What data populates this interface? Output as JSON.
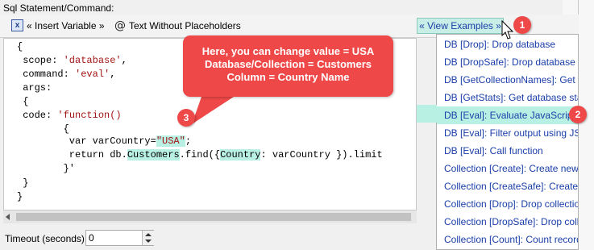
{
  "section_label": "Sql Statement/Command:",
  "toolbar": {
    "insert_variable_icon": "x",
    "insert_variable_label": "« Insert Variable »",
    "text_without_placeholders_icon": "@",
    "text_without_placeholders_label": "Text Without Placeholders",
    "view_examples_label": "« View Examples »"
  },
  "code": {
    "l1": "{",
    "l2a": " scope: ",
    "l2b": "'database'",
    "l2c": ",",
    "l3a": " command: ",
    "l3b": "'eval'",
    "l3c": ",",
    "l4": " args:",
    "l5": " {",
    "l6a": " code: ",
    "l6b": "'function()",
    "l7": "        {",
    "l8a": "         var varCountry=",
    "l8b": "\"USA\"",
    "l8c": ";",
    "l9a": "         return db.",
    "l9b": "Customers",
    "l9c": ".find({",
    "l9d": "Country",
    "l9e": ": varCountry }).limit",
    "l10": "        }'",
    "l11": " }",
    "l12": "}"
  },
  "timeout": {
    "label": "Timeout (seconds):",
    "value": "0"
  },
  "examples_menu": {
    "items": [
      "DB [Drop]: Drop database",
      "DB [DropSafe]: Drop database if exis",
      "DB [GetCollectionNames]: Get colle",
      "DB [GetStats]: Get database statistic",
      "DB [Eval]: Evaluate JavaScript",
      "DB [Eval]: Filter output using JSONP",
      "DB [Eval]: Call function",
      "Collection [Create]: Create new coll",
      "Collection [CreateSafe]: Create new",
      "Collection [Drop]: Drop collection",
      "Collection [DropSafe]: Drop collecti",
      "Collection [Count]: Count records"
    ],
    "selected_index": 4
  },
  "callout": {
    "line1": "Here, you can change value = USA",
    "line2": "Database/Collection = Customers",
    "line3": "Column = Country Name"
  },
  "badges": {
    "b1": "1",
    "b2": "2",
    "b3": "3"
  },
  "colors": {
    "callout": "#ee4848",
    "highlight": "#b9f0e4",
    "link": "#1a3ea8",
    "string": "#a31515"
  }
}
